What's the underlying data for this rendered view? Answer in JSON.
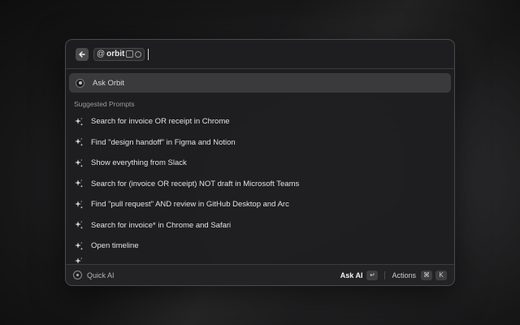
{
  "search": {
    "chip_prefix": "@",
    "chip_name": "orbit",
    "placeholder": ""
  },
  "ask_row": {
    "label": "Ask Orbit"
  },
  "section_title": "Suggested Prompts",
  "prompts": [
    "Search for invoice OR receipt in Chrome",
    "Find \"design handoff\" in Figma and Notion",
    "Show everything from Slack",
    "Search for (invoice OR receipt) NOT draft in Microsoft Teams",
    "Find \"pull request\" AND review in GitHub Desktop and Arc",
    "Search for invoice* in Chrome and Safari",
    "Open timeline"
  ],
  "footer": {
    "quick_ai": "Quick AI",
    "ask_ai": "Ask AI",
    "enter_key": "↵",
    "actions": "Actions",
    "cmd_key": "⌘",
    "k_key": "K"
  },
  "icons": {
    "back": "arrow-left-icon",
    "sparkle": "sparkle-icon"
  }
}
